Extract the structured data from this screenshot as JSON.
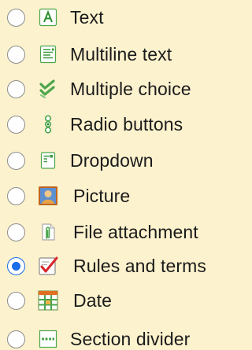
{
  "control_types": {
    "selected": "Rules and terms",
    "items": [
      {
        "label": "Text",
        "icon": "text-icon",
        "checked": false
      },
      {
        "label": "Multiline text",
        "icon": "multiline-text-icon",
        "checked": false
      },
      {
        "label": "Multiple choice",
        "icon": "multiple-choice-icon",
        "checked": false
      },
      {
        "label": "Radio buttons",
        "icon": "radio-buttons-icon",
        "checked": false
      },
      {
        "label": "Dropdown",
        "icon": "dropdown-icon",
        "checked": false
      },
      {
        "label": "Picture",
        "icon": "picture-icon",
        "checked": false
      },
      {
        "label": "File attachment",
        "icon": "file-attachment-icon",
        "checked": false
      },
      {
        "label": "Rules and terms",
        "icon": "rules-and-terms-icon",
        "checked": true
      },
      {
        "label": "Date",
        "icon": "date-icon",
        "checked": false
      },
      {
        "label": "Section divider",
        "icon": "section-divider-icon",
        "checked": false
      }
    ]
  },
  "colors": {
    "background": "#FCF2CE",
    "radio_selected": "#1A6CE8",
    "icon_green": "#4CA64C",
    "check_red": "#D9262C"
  }
}
